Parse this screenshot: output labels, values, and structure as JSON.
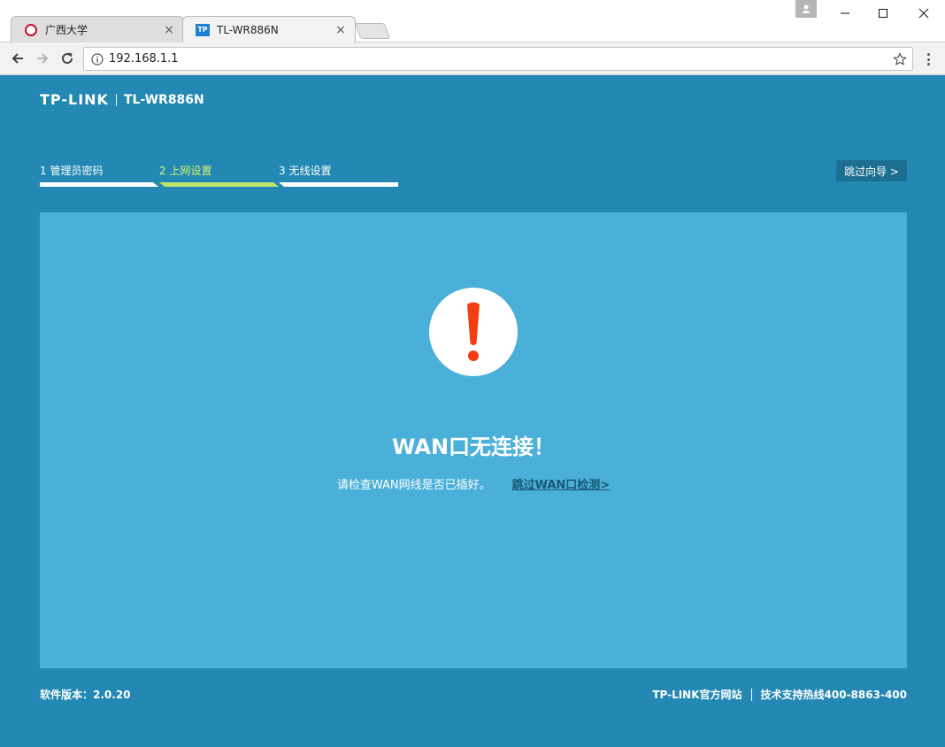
{
  "browser": {
    "tabs": [
      {
        "title": "广西大学",
        "icon": "gxu-logo-icon",
        "active": false
      },
      {
        "title": "TL-WR886N",
        "icon": "tp-link-icon",
        "active": true
      }
    ],
    "tab_close_glyph": "×",
    "url": "192.168.1.1"
  },
  "header": {
    "brand_logo": "TP-LINK",
    "model": "TL-WR886N"
  },
  "wizard": {
    "steps": [
      {
        "label": "1 管理员密码"
      },
      {
        "label": "2 上网设置"
      },
      {
        "label": "3 无线设置"
      }
    ],
    "current_step": 2,
    "skip_label": "跳过向导 >"
  },
  "panel": {
    "icon": "exclamation-icon",
    "title": "WAN口无连接！",
    "message": "请检查WAN网线是否已插好。",
    "skip_link": "跳过WAN口检测>"
  },
  "footer": {
    "version": "软件版本：2.0.20",
    "official_site": "TP-LINK官方网站",
    "hotline": "技术支持热线400-8863-400"
  },
  "colors": {
    "page_bg": "#2388b3",
    "panel_bg": "#4ab0d9",
    "active_step": "#bde36b",
    "alert_red": "#f23d13",
    "link": "#1a5876"
  }
}
